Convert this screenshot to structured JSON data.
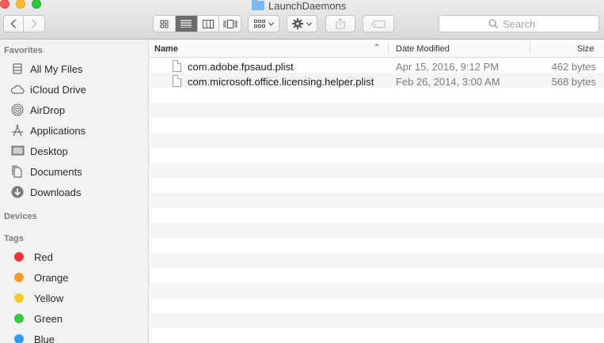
{
  "window": {
    "title": "LaunchDaemons"
  },
  "toolbar": {
    "search_placeholder": "Search"
  },
  "sidebar": {
    "favorites_label": "Favorites",
    "favorites": [
      {
        "label": "All My Files",
        "icon": "all-files-icon"
      },
      {
        "label": "iCloud Drive",
        "icon": "cloud-icon"
      },
      {
        "label": "AirDrop",
        "icon": "airdrop-icon"
      },
      {
        "label": "Applications",
        "icon": "applications-icon"
      },
      {
        "label": "Desktop",
        "icon": "desktop-icon"
      },
      {
        "label": "Documents",
        "icon": "documents-icon"
      },
      {
        "label": "Downloads",
        "icon": "downloads-icon"
      }
    ],
    "devices_label": "Devices",
    "tags_label": "Tags",
    "tags": [
      {
        "label": "Red",
        "color": "#f5313a"
      },
      {
        "label": "Orange",
        "color": "#f79a2b"
      },
      {
        "label": "Yellow",
        "color": "#f5c928"
      },
      {
        "label": "Green",
        "color": "#36c840"
      },
      {
        "label": "Blue",
        "color": "#2f9bf4"
      }
    ]
  },
  "list": {
    "columns": {
      "name": "Name",
      "date": "Date Modified",
      "size": "Size"
    },
    "files": [
      {
        "name": "com.adobe.fpsaud.plist",
        "date": "Apr 15, 2016, 9:12 PM",
        "size": "462 bytes"
      },
      {
        "name": "com.microsoft.office.licensing.helper.plist",
        "date": "Feb 26, 2014, 3:00 AM",
        "size": "568 bytes"
      }
    ]
  }
}
